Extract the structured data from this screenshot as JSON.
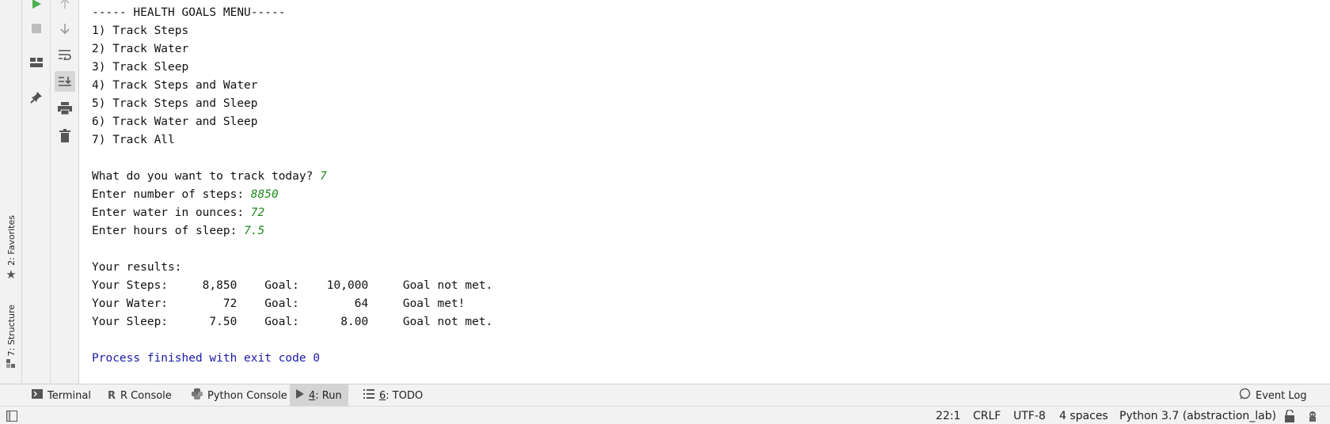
{
  "console": {
    "top_partial": "- - - ---- -- ---   - - -   - - -   - - - - - -    - - - -   - -",
    "menu_title": "----- HEALTH GOALS MENU-----",
    "menu_items": [
      "1) Track Steps",
      "2) Track Water",
      "3) Track Sleep",
      "4) Track Steps and Water",
      "5) Track Steps and Sleep",
      "6) Track Water and Sleep",
      "7) Track All"
    ],
    "prompts": [
      {
        "label": "What do you want to track today? ",
        "value": "7"
      },
      {
        "label": "Enter number of steps: ",
        "value": "8850"
      },
      {
        "label": "Enter water in ounces: ",
        "value": "72"
      },
      {
        "label": "Enter hours of sleep: ",
        "value": "7.5"
      }
    ],
    "results_title": "Your results:",
    "results": [
      "Your Steps:     8,850    Goal:    10,000     Goal not met.",
      "Your Water:        72    Goal:        64     Goal met!",
      "Your Sleep:      7.50    Goal:      8.00     Goal not met."
    ],
    "exit_message": "Process finished with exit code 0"
  },
  "side_tabs": {
    "favorites": "2: Favorites",
    "structure": "7: Structure"
  },
  "bottom_tabs": [
    {
      "label": "Terminal"
    },
    {
      "label": "R Console"
    },
    {
      "label": "Python Console"
    },
    {
      "prefix": "4",
      "label": ": Run"
    },
    {
      "prefix": "6",
      "label": ": TODO"
    }
  ],
  "event_log": "Event Log",
  "status": {
    "position": "22:1",
    "line_sep": "CRLF",
    "encoding": "UTF-8",
    "indent": "4 spaces",
    "interpreter": "Python 3.7 (abstraction_lab)"
  },
  "colors": {
    "input_green": "#1d8a1d",
    "system_blue": "#1a1aa6",
    "run_green": "#4caf50"
  }
}
